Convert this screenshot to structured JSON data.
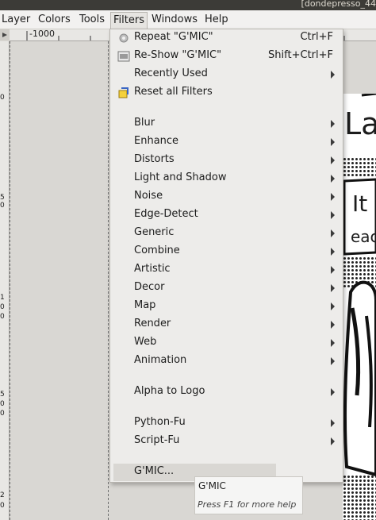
{
  "window": {
    "title": "[dondepresso_44"
  },
  "menubar": [
    "Layer",
    "Colors",
    "Tools",
    "Filters",
    "Windows",
    "Help"
  ],
  "ruler": {
    "top_label": "-1000",
    "left_labels": [
      "0",
      "5",
      "0",
      "1",
      "0",
      "0",
      "5",
      "0",
      "0",
      "2",
      "0"
    ]
  },
  "filters_menu": {
    "items": [
      {
        "label": "Repeat \"G'MIC\"",
        "accel": "Ctrl+F",
        "icon": "repeat-icon"
      },
      {
        "label": "Re-Show \"G'MIC\"",
        "accel": "Shift+Ctrl+F",
        "icon": "reshow-icon"
      },
      {
        "label": "Recently Used",
        "submenu": true
      },
      {
        "label": "Reset all Filters",
        "icon": "reset-icon"
      },
      {
        "label": "Blur",
        "submenu": true
      },
      {
        "label": "Enhance",
        "submenu": true
      },
      {
        "label": "Distorts",
        "submenu": true
      },
      {
        "label": "Light and Shadow",
        "submenu": true
      },
      {
        "label": "Noise",
        "submenu": true
      },
      {
        "label": "Edge-Detect",
        "submenu": true
      },
      {
        "label": "Generic",
        "submenu": true
      },
      {
        "label": "Combine",
        "submenu": true
      },
      {
        "label": "Artistic",
        "submenu": true
      },
      {
        "label": "Decor",
        "submenu": true
      },
      {
        "label": "Map",
        "submenu": true
      },
      {
        "label": "Render",
        "submenu": true
      },
      {
        "label": "Web",
        "submenu": true
      },
      {
        "label": "Animation",
        "submenu": true
      },
      {
        "label": "Alpha to Logo",
        "submenu": true
      },
      {
        "label": "Python-Fu",
        "submenu": true
      },
      {
        "label": "Script-Fu",
        "submenu": true
      },
      {
        "label": "G'MIC..."
      }
    ]
  },
  "tooltip": {
    "title": "G'MIC",
    "help": "Press F1 for more help"
  },
  "canvas_text": {
    "big": "La",
    "speech": "It",
    "speech2": "eac"
  }
}
